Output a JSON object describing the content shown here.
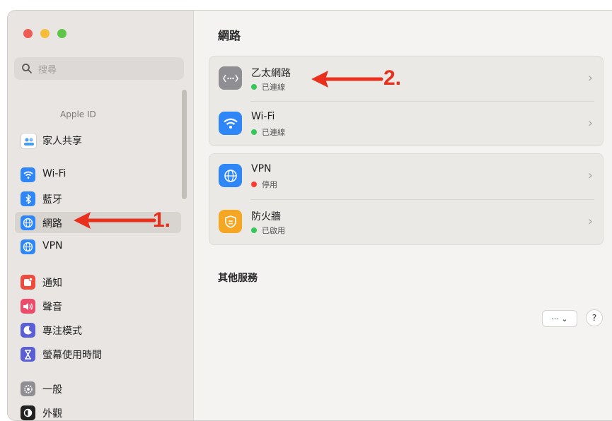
{
  "sidebar": {
    "search_placeholder": "搜尋",
    "apple_id_label": "Apple ID",
    "items": [
      {
        "label": "家人共享",
        "icon": "family-sharing-icon",
        "color": "#6fa8dc"
      },
      {
        "label": "Wi-Fi",
        "icon": "wifi-icon",
        "color": "#2f86f6"
      },
      {
        "label": "藍牙",
        "icon": "bluetooth-icon",
        "color": "#2f86f6"
      },
      {
        "label": "網路",
        "icon": "network-globe-icon",
        "color": "#2f86f6",
        "selected": true
      },
      {
        "label": "VPN",
        "icon": "vpn-globe-icon",
        "color": "#2f86f6"
      },
      {
        "label": "通知",
        "icon": "notifications-icon",
        "color": "#ec4b3e"
      },
      {
        "label": "聲音",
        "icon": "sound-icon",
        "color": "#ec4b69"
      },
      {
        "label": "專注模式",
        "icon": "focus-moon-icon",
        "color": "#5a5fd6"
      },
      {
        "label": "螢幕使用時間",
        "icon": "hourglass-icon",
        "color": "#5a5fd6"
      },
      {
        "label": "一般",
        "icon": "gear-icon",
        "color": "#8e8e93"
      },
      {
        "label": "外觀",
        "icon": "appearance-icon",
        "color": "#222222"
      }
    ]
  },
  "main": {
    "title": "網路",
    "groups": [
      {
        "rows": [
          {
            "title": "乙太網路",
            "status": "已連線",
            "status_color": "#34c759",
            "icon": "ethernet-icon",
            "icon_color": "#8e8e93"
          },
          {
            "title": "Wi-Fi",
            "status": "已連線",
            "status_color": "#34c759",
            "icon": "wifi-icon",
            "icon_color": "#2f86f6"
          }
        ]
      },
      {
        "rows": [
          {
            "title": "VPN",
            "status": "停用",
            "status_color": "#ff3b30",
            "icon": "vpn-globe-icon",
            "icon_color": "#2f86f6"
          },
          {
            "title": "防火牆",
            "status": "已啟用",
            "status_color": "#34c759",
            "icon": "firewall-icon",
            "icon_color": "#f5a623"
          }
        ]
      }
    ],
    "other_services_title": "其他服務",
    "more_button_label": "··· ⌄",
    "help_button_label": "?"
  },
  "annotations": {
    "arrow1_label": "1.",
    "arrow2_label": "2.",
    "color": "#e8301c"
  }
}
